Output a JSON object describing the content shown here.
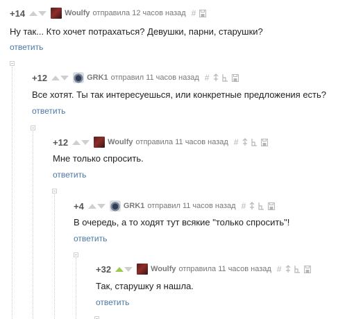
{
  "comments": [
    {
      "rating": "+14",
      "author": "Woulfy",
      "posted": "отправила 12 часов назад",
      "text": "Ну так... Кто хочет потрахаться? Девушки, парни, старушки?",
      "reply": "ответить",
      "avatar": "woulfy-avatar",
      "tools": [
        "hash-icon",
        "save-icon"
      ]
    },
    {
      "rating": "+12",
      "author": "GRK1",
      "posted": "отправил 11 часов назад",
      "text": "Все хотят. Ты так интересуешься, или конкретные предложения есть?",
      "reply": "ответить",
      "avatar": "grk1-avatar",
      "tools": [
        "hash-icon",
        "parent-arrow-icon",
        "thread-icon",
        "save-icon"
      ]
    },
    {
      "rating": "+12",
      "author": "Woulfy",
      "posted": "отправила 11 часов назад",
      "text": "Мне только спросить.",
      "reply": "ответить",
      "avatar": "woulfy-avatar",
      "tools": [
        "hash-icon",
        "parent-arrow-icon",
        "thread-icon",
        "save-icon"
      ]
    },
    {
      "rating": "+4",
      "author": "GRK1",
      "posted": "отправил 11 часов назад",
      "text": "В очередь, а то ходят тут всякие \"только спросить\"!",
      "reply": "ответить",
      "avatar": "grk1-avatar",
      "tools": [
        "hash-icon",
        "parent-arrow-icon",
        "thread-icon",
        "save-icon"
      ]
    },
    {
      "rating": "+32",
      "author": "Woulfy",
      "posted": "отправила 11 часов назад",
      "text": "Так, старушку я нашла.",
      "reply": "ответить",
      "avatar": "woulfy-avatar",
      "upvoted": true,
      "tools": [
        "hash-icon",
        "parent-arrow-icon",
        "thread-icon",
        "save-icon"
      ]
    }
  ],
  "glyphs": {
    "hash": "#"
  },
  "colors": {
    "rating": "#555555",
    "author": "#7a7a7a",
    "link": "#4a78a6",
    "upvote_active": "#9acb4e",
    "arrow_idle": "#cfcfcf"
  }
}
